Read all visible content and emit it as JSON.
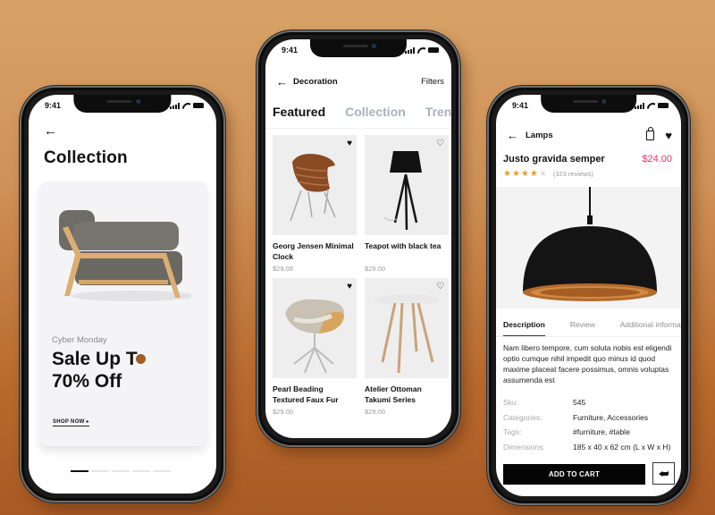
{
  "status_time": "9:41",
  "collection_screen": {
    "title": "Collection",
    "banner": {
      "eyebrow": "Cyber Monday",
      "headline_line1": "Sale Up T",
      "headline_line2": "70% Off",
      "cta": "SHOP NOW ▸",
      "accent_color": "#a55d23"
    },
    "pager": {
      "total": 5,
      "active_index": 0
    }
  },
  "decoration_screen": {
    "nav": {
      "title": "Decoration",
      "filters_label": "Filters"
    },
    "tabs": [
      {
        "label": "Featured",
        "active": true
      },
      {
        "label": "Collection",
        "active": false
      },
      {
        "label": "Trending",
        "active": false
      }
    ],
    "products": [
      {
        "name": "Georg Jensen Minimal Clock",
        "price": "$29.00",
        "favorite": true,
        "image": "brown-chair"
      },
      {
        "name": "Teapot with black tea",
        "price": "$29.00",
        "favorite": false,
        "image": "tripod-lamp"
      },
      {
        "name": "Pearl Beading Textured Faux Fur",
        "price": "$29.00",
        "favorite": true,
        "image": "swivel-chair"
      },
      {
        "name": "Atelier Ottoman Takumi Series",
        "price": "$29.00",
        "favorite": false,
        "image": "round-table"
      }
    ]
  },
  "product_screen": {
    "nav": {
      "title": "Lamps"
    },
    "product": {
      "name": "Justo gravida semper",
      "price": "$24.00",
      "price_color": "#e4386b",
      "rating": 4,
      "rating_max": 5,
      "reviews": "(323 reviews)"
    },
    "tabs": [
      {
        "label": "Description",
        "active": true
      },
      {
        "label": "Review",
        "active": false
      },
      {
        "label": "Additional information",
        "active": false
      }
    ],
    "description": "Nam libero tempore, cum soluta nobis est eligendi optio cumque nihil impedit quo minus id quod maxime placeat facere possimus, omnis voluptas assumenda est",
    "specs": [
      {
        "key": "Sku:",
        "value": "545"
      },
      {
        "key": "Categories:",
        "value": "Furniture, Accessories"
      },
      {
        "key": "Tags:",
        "value": "#furniture, #table"
      },
      {
        "key": "Dimensions:",
        "value": "185 x 40 x 62 cm (L x W x H)"
      }
    ],
    "add_to_cart_label": "ADD TO CART"
  }
}
